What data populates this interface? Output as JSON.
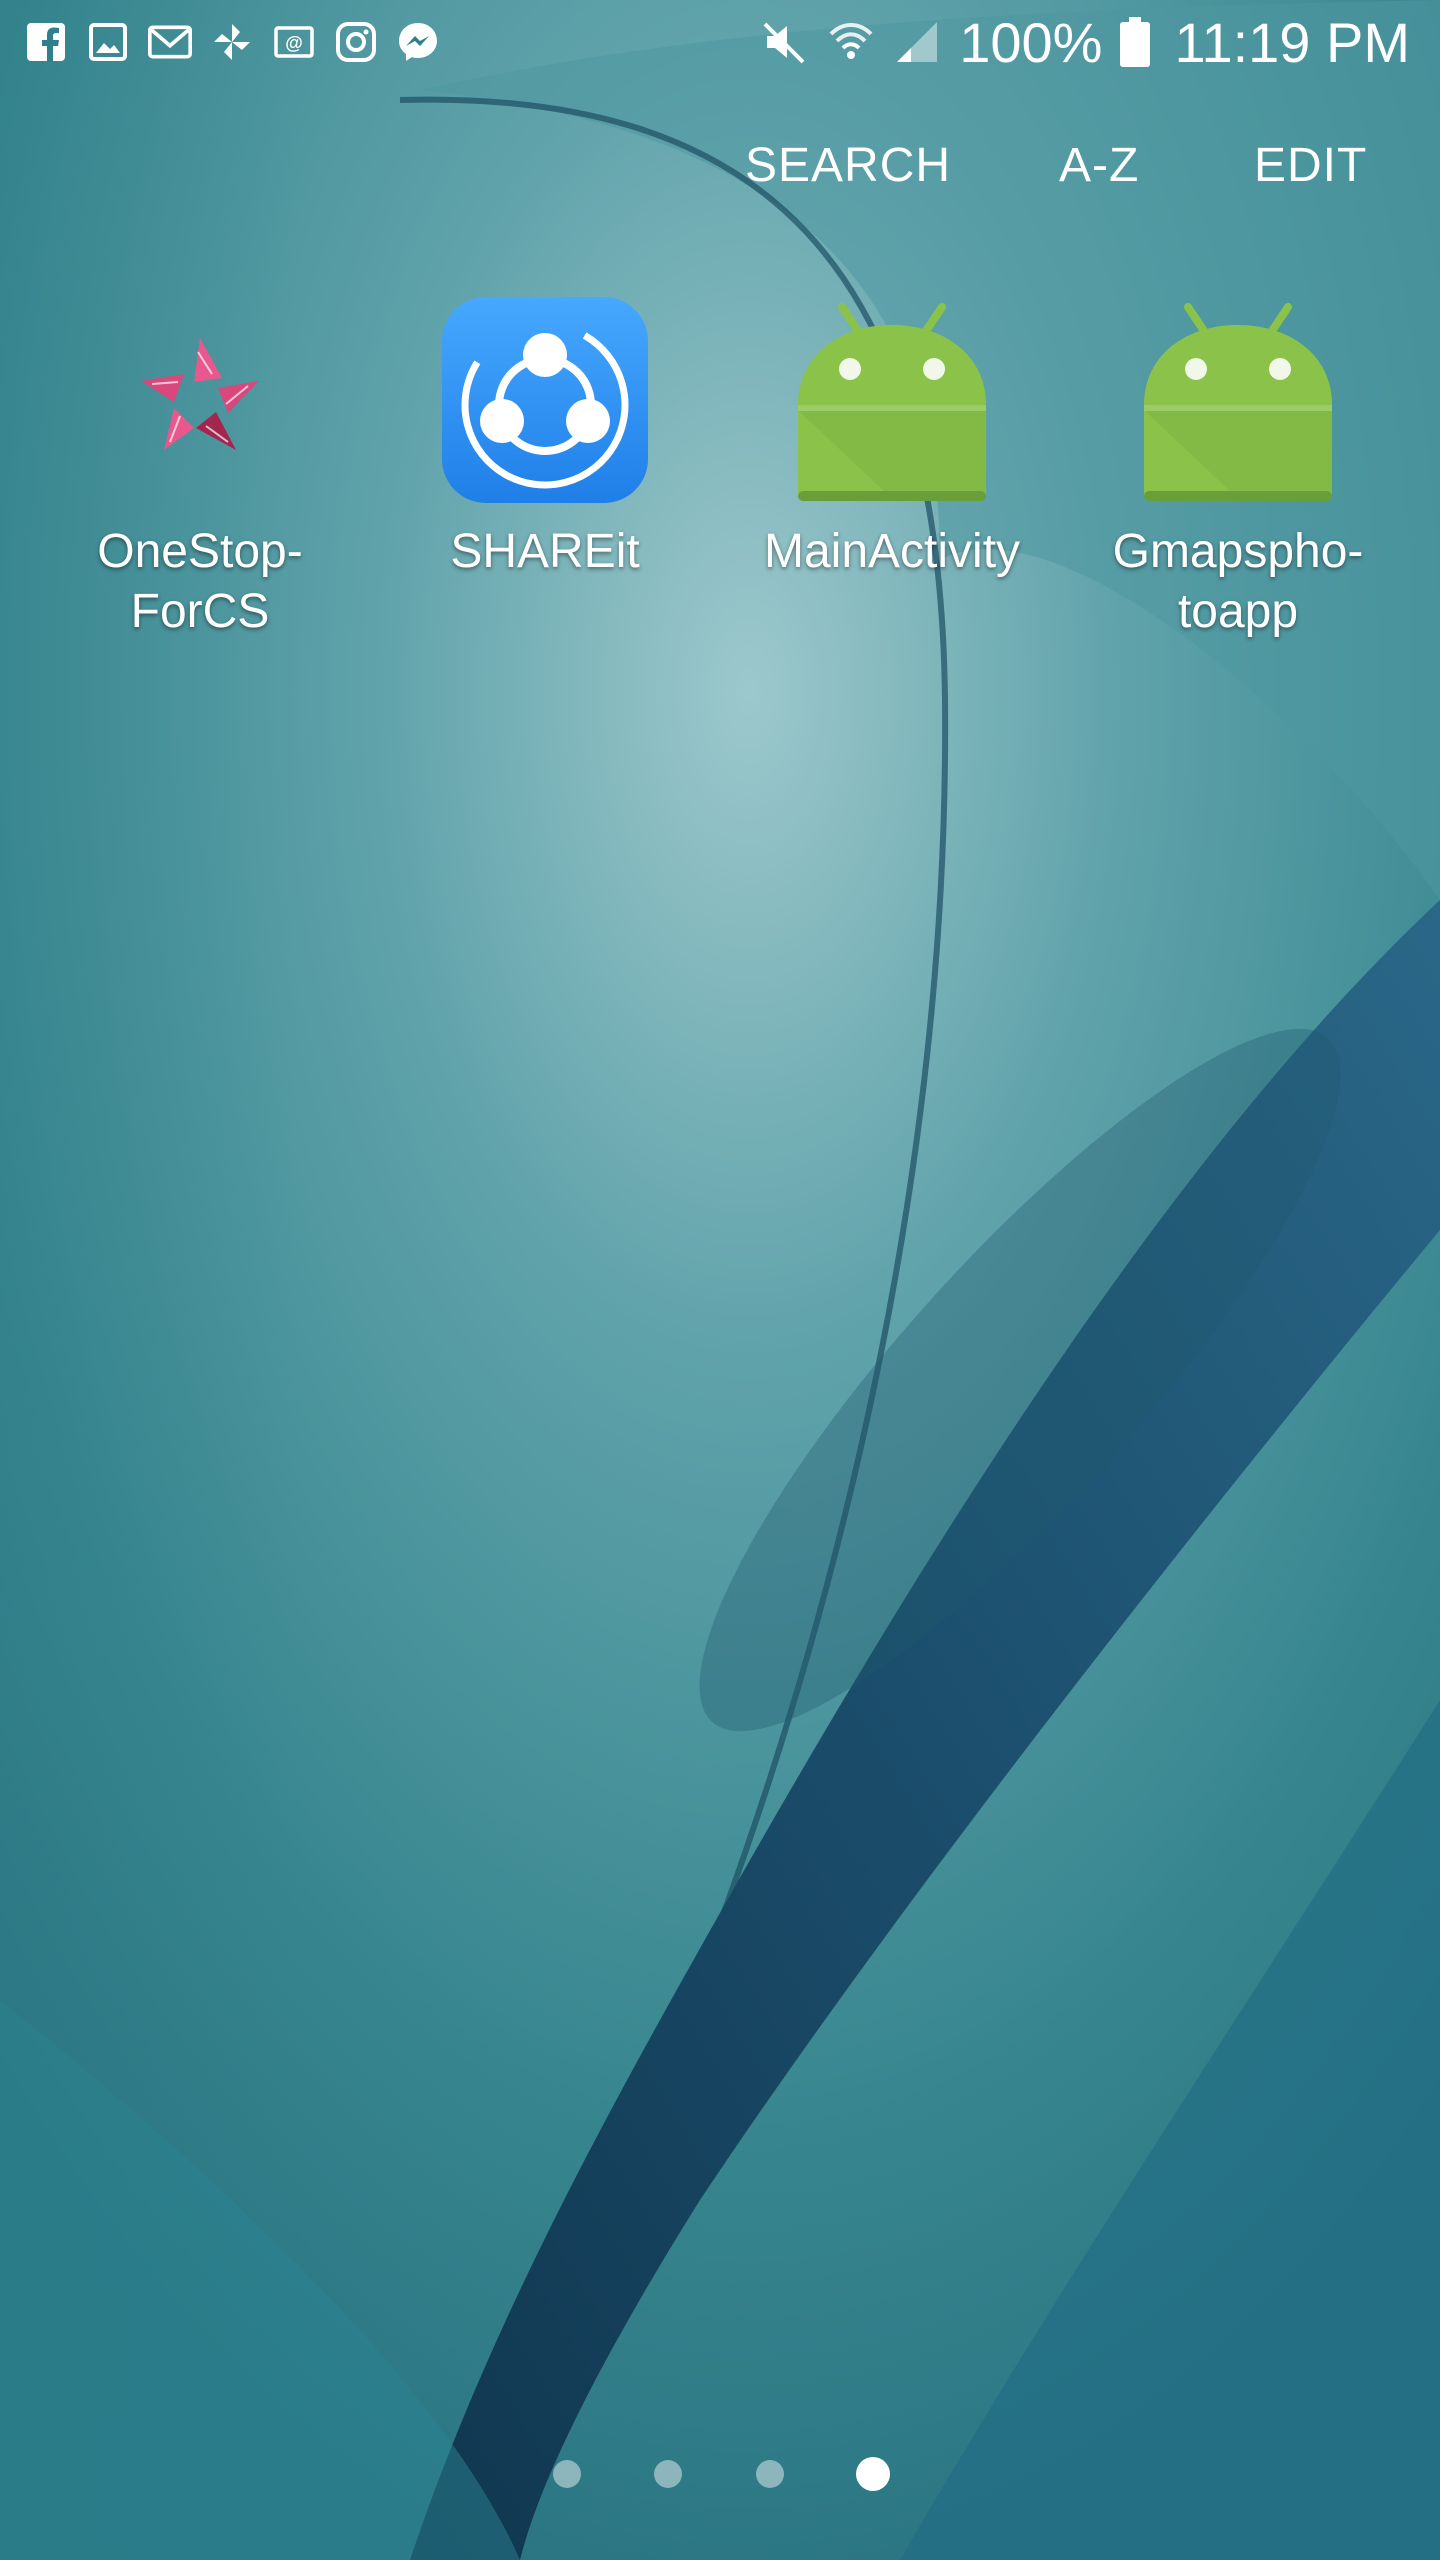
{
  "status_bar": {
    "notification_icons": [
      "facebook-icon",
      "gallery-icon",
      "gmail-icon",
      "pinwheel-icon",
      "email-icon",
      "instagram-icon",
      "messenger-icon"
    ],
    "system_icons": [
      "mute-icon",
      "wifi-icon",
      "cellular-signal-icon",
      "battery-icon"
    ],
    "battery": "100%",
    "time": "11:19 PM"
  },
  "top_menu": {
    "search_label": "SEARCH",
    "az_label": "A-Z",
    "edit_label": "EDIT"
  },
  "apps": [
    {
      "label": "OneStop-\nForCS",
      "icon": "onestop-star-hands-icon"
    },
    {
      "label": "SHAREit",
      "icon": "shareit-icon"
    },
    {
      "label": "MainActivity",
      "icon": "android-robot-icon"
    },
    {
      "label": "Gmapspho-\ntoapp",
      "icon": "android-robot-icon"
    }
  ],
  "page_indicator": {
    "page_count": 4,
    "current_page": 4
  },
  "colors": {
    "wallpaper_base": "#2f7f8c",
    "wallpaper_dark": "#0f3d5a",
    "android_green": "#8bc34a",
    "shareit_blue": "#2f8ff0",
    "onestop_pink": "#e8588c"
  }
}
